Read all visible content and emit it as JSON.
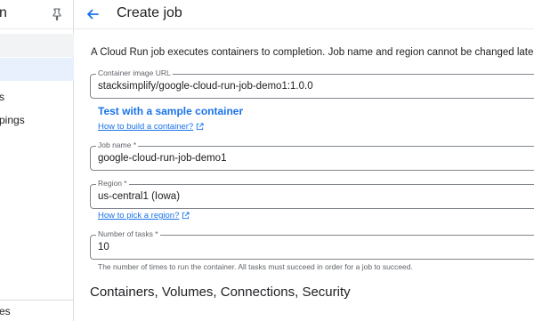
{
  "sidebar": {
    "header_fragment": "n",
    "items": [
      {
        "label": ""
      },
      {
        "label": ""
      },
      {
        "label": "s"
      },
      {
        "label": "pings"
      }
    ],
    "bottom_fragment": "es"
  },
  "header": {
    "title": "Create job"
  },
  "main": {
    "intro": "A Cloud Run job executes containers to completion. Job name and region cannot be changed later.",
    "container_image": {
      "label": "Container image URL",
      "value": "stacksimplify/google-cloud-run-job-demo1:1.0.0"
    },
    "sample_link": "Test with a sample container",
    "build_help_link": "How to build a container?",
    "job_name": {
      "label": "Job name *",
      "value": "google-cloud-run-job-demo1"
    },
    "region": {
      "label": "Region *",
      "value": "us-central1 (Iowa)"
    },
    "region_help_link": "How to pick a region?",
    "tasks": {
      "label": "Number of tasks *",
      "value": "10",
      "hint": "The number of times to run the container. All tasks must succeed in order for a job to succeed."
    },
    "section_heading": "Containers, Volumes, Connections, Security"
  },
  "colors": {
    "accent": "#1a73e8",
    "selected_bg": "#e8f0fe",
    "border": "#80868b"
  },
  "icons": [
    "pin-icon",
    "back-arrow-icon",
    "external-link-icon"
  ]
}
